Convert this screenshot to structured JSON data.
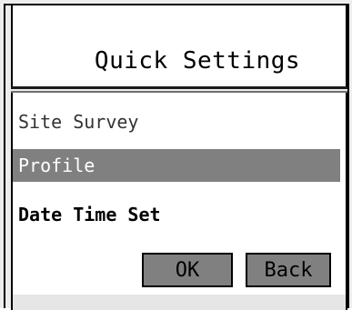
{
  "dialog": {
    "title": "Quick Settings",
    "items": [
      {
        "label": "Site Survey",
        "selected": false
      },
      {
        "label": "Profile",
        "selected": true
      },
      {
        "label": "Date Time Set",
        "selected": false
      }
    ],
    "buttons": {
      "ok_label": "OK",
      "back_label": "Back"
    }
  },
  "colors": {
    "selection": "#808080",
    "button": "#808080",
    "border": "#000000"
  }
}
